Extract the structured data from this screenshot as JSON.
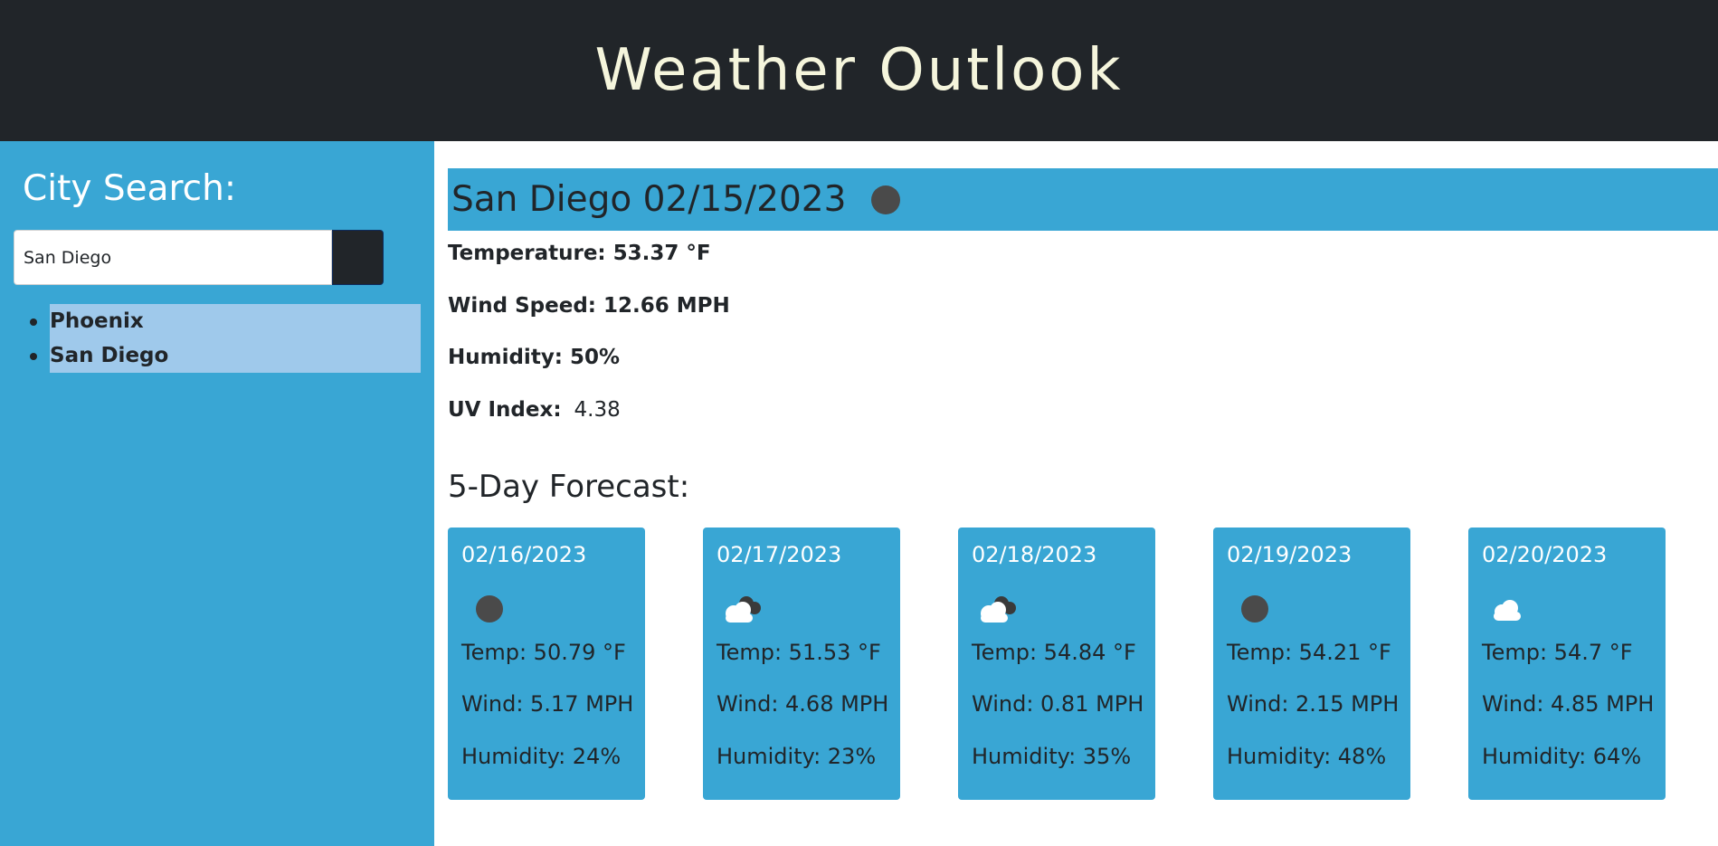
{
  "header": {
    "title": "Weather Outlook"
  },
  "sidebar": {
    "title": "City Search:",
    "search": {
      "value": "San Diego",
      "placeholder": ""
    },
    "history": [
      "Phoenix",
      "San Diego"
    ]
  },
  "current": {
    "title": "San Diego 02/15/2023",
    "icon": "dark-circle-icon",
    "temperature": "Temperature: 53.37 °F",
    "wind": "Wind Speed: 12.66 MPH",
    "humidity": "Humidity: 50%",
    "uv_label": "UV Index:",
    "uv_value": "4.38"
  },
  "forecast": {
    "title": "5-Day Forecast:",
    "days": [
      {
        "date": "02/16/2023",
        "icon": "dark-circle-icon",
        "temp": "Temp: 50.79 °F",
        "wind": "Wind: 5.17 MPH",
        "humidity": "Humidity: 24%"
      },
      {
        "date": "02/17/2023",
        "icon": "broken-clouds-icon",
        "temp": "Temp: 51.53 °F",
        "wind": "Wind: 4.68 MPH",
        "humidity": "Humidity: 23%"
      },
      {
        "date": "02/18/2023",
        "icon": "broken-clouds-icon",
        "temp": "Temp: 54.84 °F",
        "wind": "Wind: 0.81 MPH",
        "humidity": "Humidity: 35%"
      },
      {
        "date": "02/19/2023",
        "icon": "dark-circle-icon",
        "temp": "Temp: 54.21 °F",
        "wind": "Wind: 2.15 MPH",
        "humidity": "Humidity: 48%"
      },
      {
        "date": "02/20/2023",
        "icon": "cloud-icon",
        "temp": "Temp: 54.7 °F",
        "wind": "Wind: 4.85 MPH",
        "humidity": "Humidity: 64%"
      }
    ]
  },
  "colors": {
    "header_bg": "#212529",
    "title_text": "#f5f5dc",
    "accent_blue": "#39a6d4",
    "history_highlight": "#9fc9eb"
  }
}
